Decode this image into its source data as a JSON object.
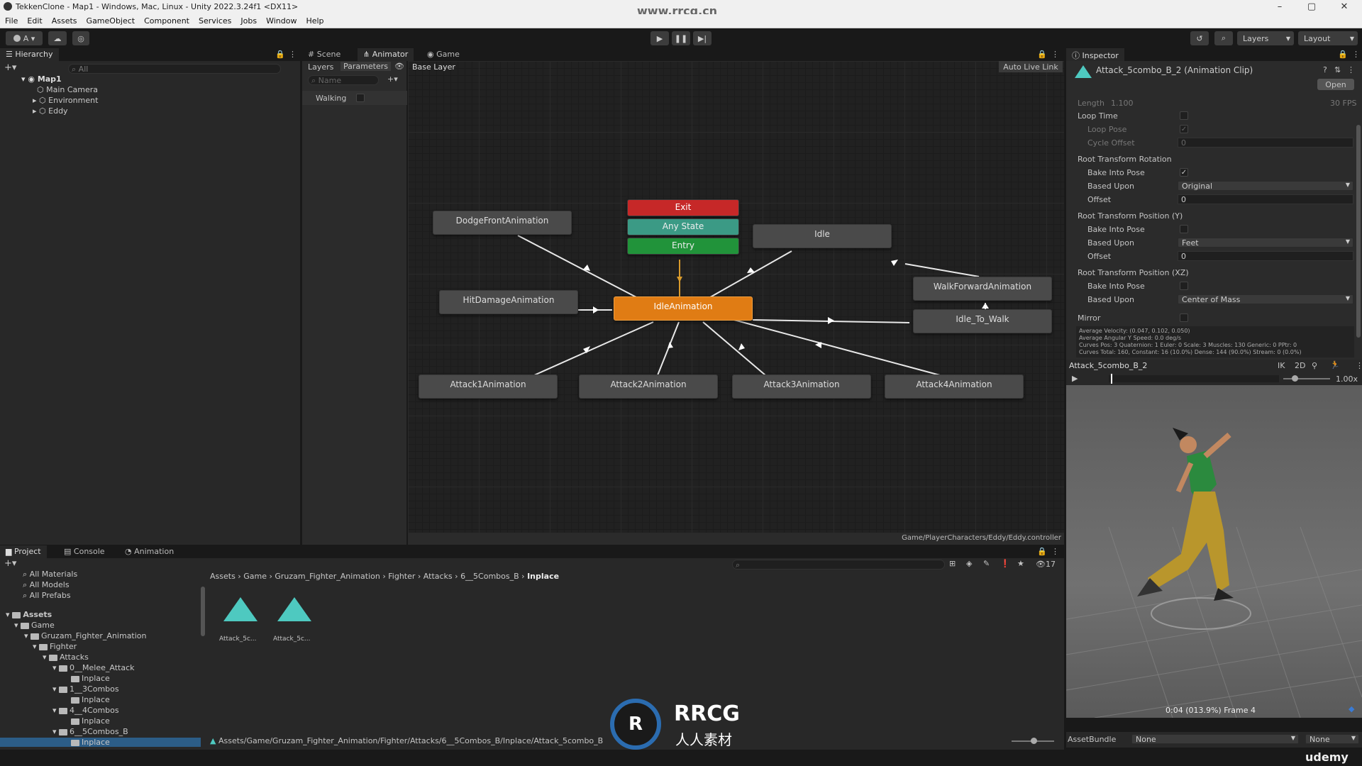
{
  "window": {
    "title": "TekkenClone - Map1 - Windows, Mac, Linux - Unity 2022.3.24f1 <DX11>",
    "watermark": "www.rrcg.cn"
  },
  "menu": [
    "File",
    "Edit",
    "Assets",
    "GameObject",
    "Component",
    "Services",
    "Jobs",
    "Window",
    "Help"
  ],
  "toolbar": {
    "account_label": "A ▾",
    "layers_label": "Layers",
    "layout_label": "Layout"
  },
  "hierarchy": {
    "tab": "Hierarchy",
    "search_placeholder": "All",
    "scene": "Map1",
    "items": [
      "Main Camera",
      "Environment",
      "Eddy"
    ]
  },
  "center_tabs": [
    "Scene",
    "Animator",
    "Game"
  ],
  "animator": {
    "layers_tab": "Layers",
    "parameters_tab": "Parameters",
    "breadcrumb": "Base Layer",
    "auto_live_link": "Auto Live Link",
    "search_placeholder": "Name",
    "parameter": "Walking",
    "footer_path": "Game/PlayerCharacters/Eddy/Eddy.controller",
    "nodes": {
      "exit": "Exit",
      "any_state": "Any State",
      "entry": "Entry",
      "dodge": "DodgeFrontAnimation",
      "idle": "Idle",
      "walk_forward": "WalkForwardAnimation",
      "hit_damage": "HitDamageAnimation",
      "idle_animation": "IdleAnimation",
      "idle_to_walk": "Idle_To_Walk",
      "attack1": "Attack1Animation",
      "attack2": "Attack2Animation",
      "attack3": "Attack3Animation",
      "attack4": "Attack4Animation"
    }
  },
  "inspector": {
    "tab": "Inspector",
    "clip_title": "Attack_5combo_B_2 (Animation Clip)",
    "open_button": "Open",
    "length_label": "Length",
    "length_value": "1.100",
    "fps_value": "30 FPS",
    "loop_time": "Loop Time",
    "loop_pose": "Loop Pose",
    "cycle_offset": "Cycle Offset",
    "cycle_offset_value": "0",
    "rtr_header": "Root Transform Rotation",
    "bake_into_pose": "Bake Into Pose",
    "based_upon": "Based Upon",
    "offset": "Offset",
    "rtr_based_upon_value": "Original",
    "rtr_offset_value": "0",
    "rty_header": "Root Transform Position (Y)",
    "rty_based_upon_value": "Feet",
    "rty_offset_value": "0",
    "rtxz_header": "Root Transform Position (XZ)",
    "rtxz_based_upon_value": "Center of Mass",
    "mirror": "Mirror",
    "stats": [
      "Average Velocity: (0.047, 0.102, 0.050)",
      "Average Angular Y Speed: 0.0 deg/s",
      "Curves Pos: 3 Quaternion: 1 Euler: 0 Scale: 3 Muscles: 130 Generic: 0 PPtr: 0",
      "Curves Total: 160, Constant: 16 (10.0%) Dense: 144 (90.0%) Stream: 0 (0.0%)"
    ],
    "preview_clip": "Attack_5combo_B_2",
    "preview_ik": "IK",
    "preview_2d": "2D",
    "preview_speed": "1.00x",
    "preview_time": "0:04 (013.9%) Frame 4",
    "assetbundle_label": "AssetBundle",
    "assetbundle_value": "None",
    "assetbundle_variant": "None"
  },
  "bottom_tabs": [
    "Project",
    "Console",
    "Animation"
  ],
  "project": {
    "favorites": [
      "All Materials",
      "All Models",
      "All Prefabs"
    ],
    "tree": [
      "Assets",
      "Game",
      "Gruzam_Fighter_Animation",
      "Fighter",
      "Attacks",
      "0__Melee_Attack",
      "Inplace",
      "1__3Combos",
      "Inplace",
      "4__4Combos",
      "Inplace",
      "6__5Combos_B",
      "Inplace"
    ],
    "breadcrumb": [
      "Assets",
      "Game",
      "Gruzam_Fighter_Animation",
      "Fighter",
      "Attacks",
      "6__5Combos_B",
      "Inplace"
    ],
    "assets": [
      "Attack_5c...",
      "Attack_5c..."
    ],
    "footer_path": "Assets/Game/Gruzam_Fighter_Animation/Fighter/Attacks/6__5Combos_B/Inplace/Attack_5combo_B",
    "count": "17"
  },
  "branding": {
    "logo_top": "RRCG",
    "logo_bottom": "人人素材",
    "udemy": "udemy"
  }
}
